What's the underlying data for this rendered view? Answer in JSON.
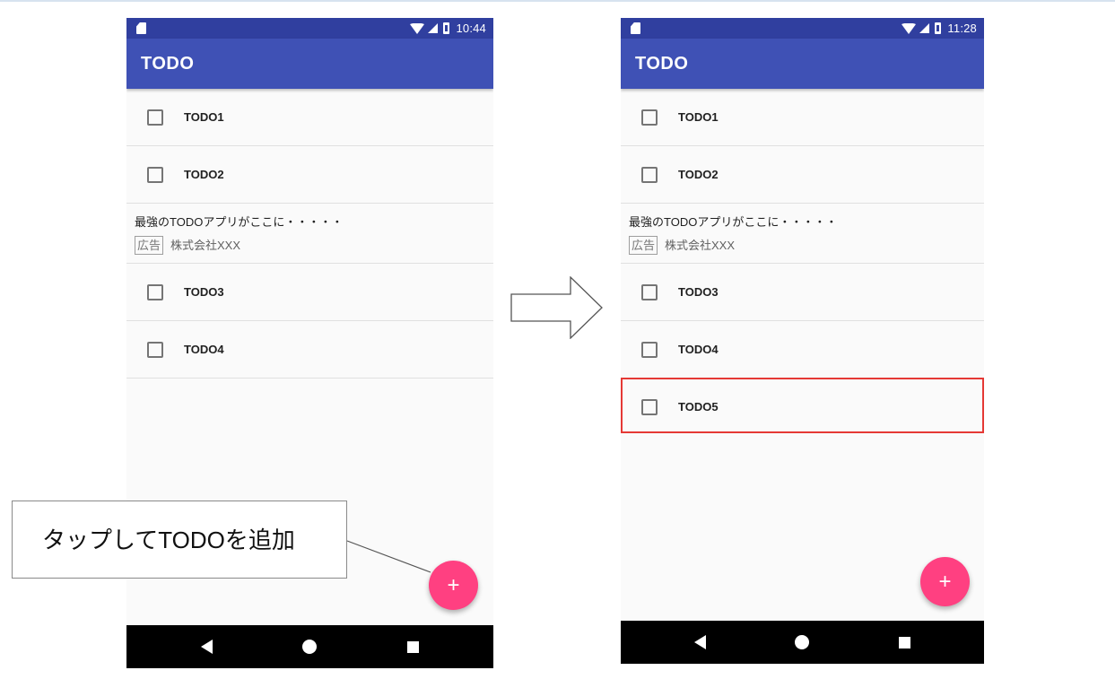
{
  "colors": {
    "status_bar": "#303f9f",
    "app_bar": "#3f51b5",
    "fab": "#ff4081",
    "highlight": "#e53935",
    "list_background": "#fafafa"
  },
  "before": {
    "status_bar": {
      "time": "10:44",
      "icons": [
        "sd-card-icon",
        "wifi-icon",
        "signal-icon",
        "battery-icon"
      ]
    },
    "app_bar": {
      "title": "TODO"
    },
    "list": [
      {
        "type": "todo",
        "label": "TODO1",
        "checked": false
      },
      {
        "type": "todo",
        "label": "TODO2",
        "checked": false
      },
      {
        "type": "ad",
        "headline": "最強のTODOアプリがここに・・・・・",
        "badge": "広告",
        "company": "株式会社XXX"
      },
      {
        "type": "todo",
        "label": "TODO3",
        "checked": false
      },
      {
        "type": "todo",
        "label": "TODO4",
        "checked": false
      }
    ],
    "fab": {
      "label": "+"
    }
  },
  "after": {
    "status_bar": {
      "time": "11:28",
      "icons": [
        "sd-card-icon",
        "wifi-icon",
        "signal-icon",
        "battery-icon"
      ]
    },
    "app_bar": {
      "title": "TODO"
    },
    "list": [
      {
        "type": "todo",
        "label": "TODO1",
        "checked": false
      },
      {
        "type": "todo",
        "label": "TODO2",
        "checked": false
      },
      {
        "type": "ad",
        "headline": "最強のTODOアプリがここに・・・・・",
        "badge": "広告",
        "company": "株式会社XXX"
      },
      {
        "type": "todo",
        "label": "TODO3",
        "checked": false
      },
      {
        "type": "todo",
        "label": "TODO4",
        "checked": false
      },
      {
        "type": "todo",
        "label": "TODO5",
        "checked": false,
        "highlighted": true
      }
    ],
    "fab": {
      "label": "+"
    }
  },
  "nav_bar": {
    "icons": [
      "back-icon",
      "home-icon",
      "recents-icon"
    ]
  },
  "callout": {
    "text": "タップしてTODOを追加"
  },
  "transition_arrow": {
    "icon": "right-arrow-icon"
  }
}
